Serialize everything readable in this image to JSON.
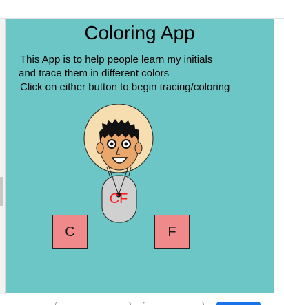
{
  "app": {
    "title": "Coloring App",
    "intro_lines": [
      "This App is to help people learn my initials",
      "and trace them in different colors",
      "Click on either button to begin tracing/coloring"
    ],
    "character_label": "CF",
    "buttons": [
      {
        "label": "C"
      },
      {
        "label": "F"
      }
    ]
  },
  "colors": {
    "canvas_background": "#6cc6c6",
    "button_fill": "#f08a8a",
    "label_color": "#ff1a1a",
    "halo": "#f6deb0",
    "skin": "#e9a76b",
    "body": "#d0d0d0",
    "primary_button": "#1a73e8"
  }
}
